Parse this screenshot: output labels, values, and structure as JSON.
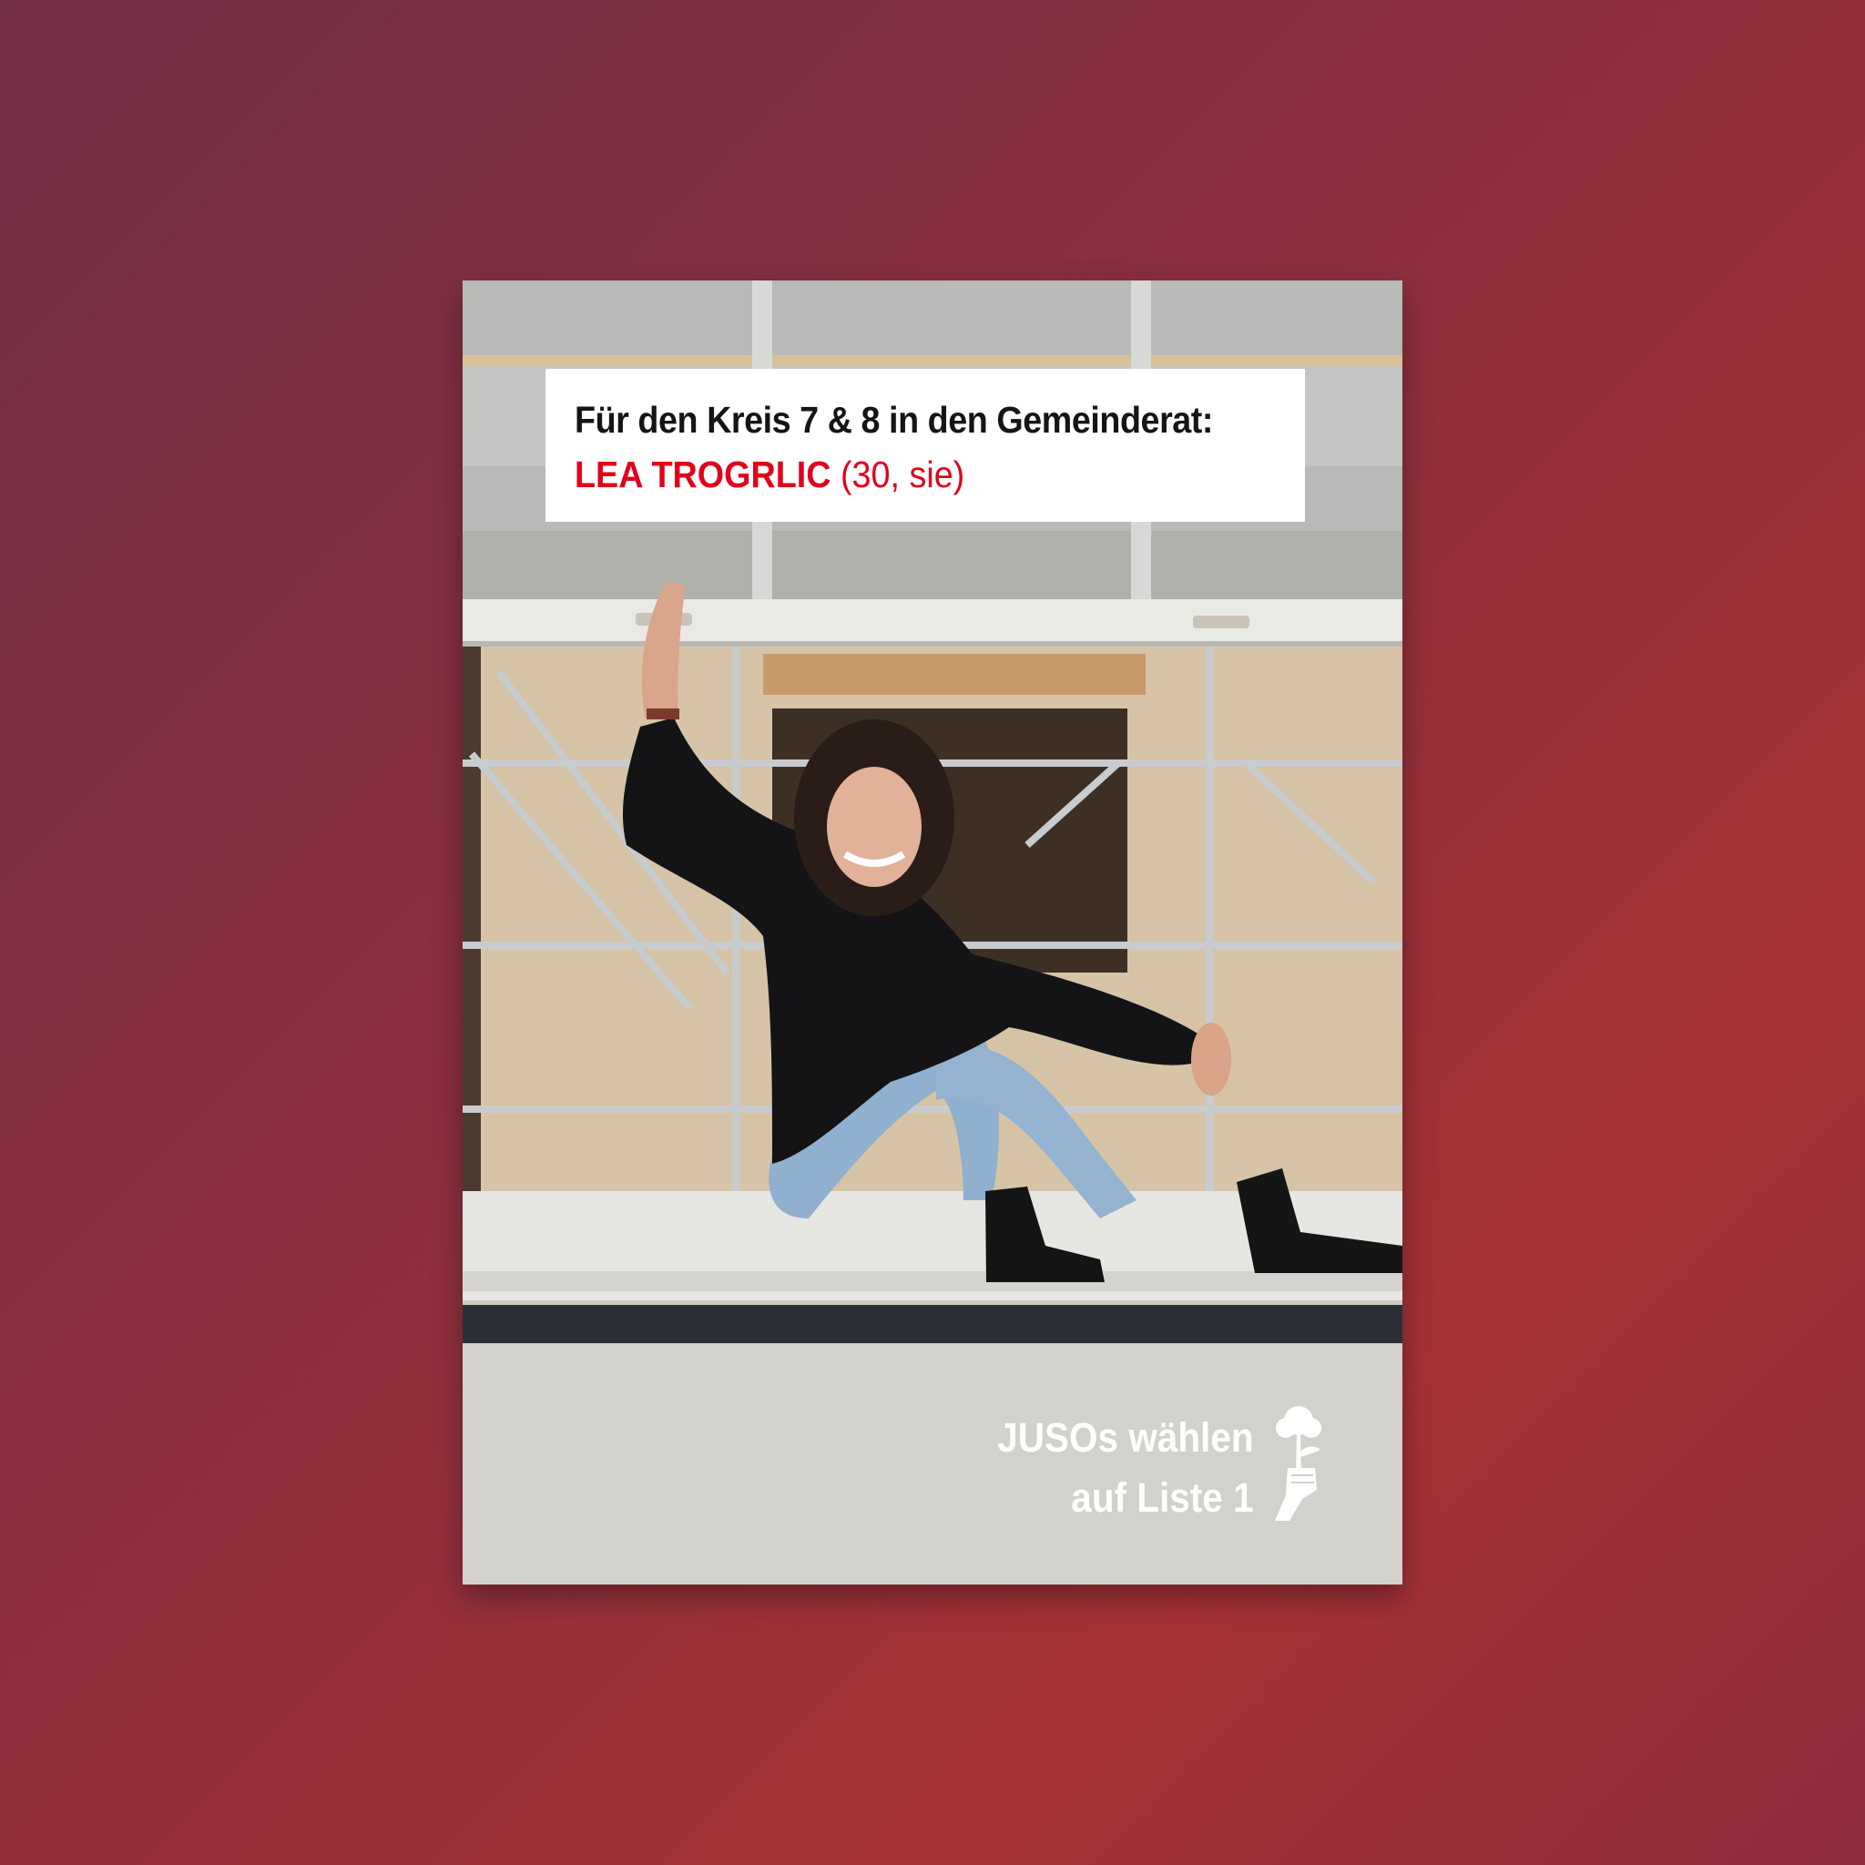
{
  "poster": {
    "headline": "Für den Kreis 7 & 8 in den Gemeinderat:",
    "candidate_name": "LEA TROGRLIC",
    "candidate_meta": "(30, sie)",
    "cta_line1": "JUSOs wählen",
    "cta_line2": "auf Liste 1",
    "logo_icon": "rose-in-fist-icon",
    "photo_description_icon": "photo"
  },
  "colors": {
    "background": "#8a2f3f",
    "accent_red": "#e2001a",
    "headline_text": "#151515",
    "box_white": "#ffffff"
  }
}
